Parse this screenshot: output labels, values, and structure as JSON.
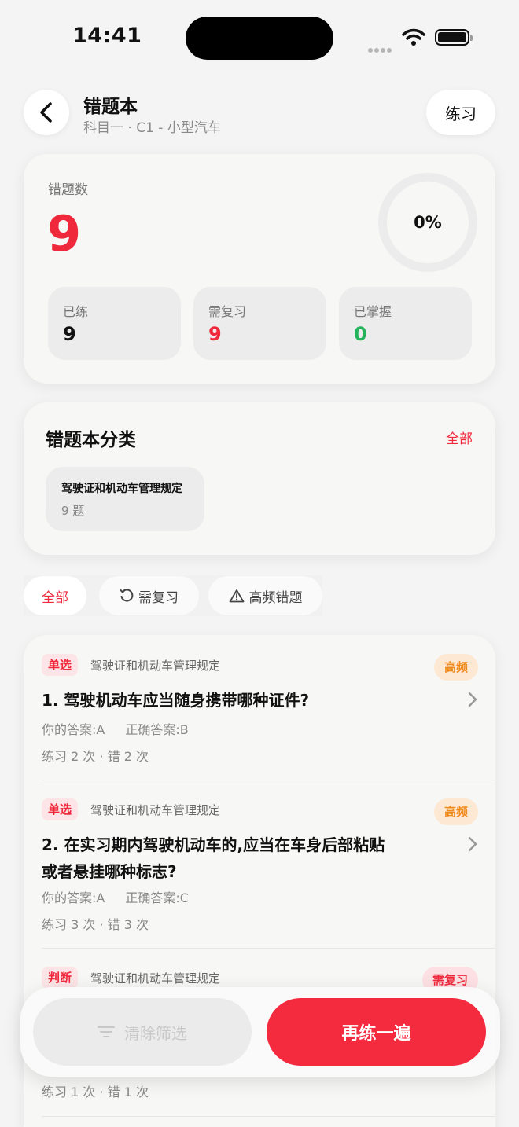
{
  "status_bar": {
    "time": "14:41"
  },
  "header": {
    "title": "错题本",
    "subtitle": "科目一 · C1 - 小型汽车",
    "practice_label": "练习"
  },
  "summary": {
    "wrong_count_label": "错题数",
    "wrong_count": "9",
    "progress_percent": "0%",
    "progress_fraction": 0,
    "stats": [
      {
        "label": "已练",
        "value": "9",
        "color": "#111111"
      },
      {
        "label": "需复习",
        "value": "9",
        "color": "#f0283c"
      },
      {
        "label": "已掌握",
        "value": "0",
        "color": "#22b35b"
      }
    ]
  },
  "categories": {
    "title": "错题本分类",
    "all_label": "全部",
    "items": [
      {
        "name": "驾驶证和机动车管理规定",
        "count": "9 题"
      }
    ]
  },
  "filters": {
    "all": "全部",
    "review": "需复习",
    "frequent": "高频错题"
  },
  "questions": [
    {
      "type": "单选",
      "category": "驾驶证和机动车管理规定",
      "badge": "高频",
      "badge_kind": "freq",
      "text": "1. 驾驶机动车应当随身携带哪种证件?",
      "your_answer": "你的答案:A",
      "correct_answer": "正确答案:B",
      "stats": "练习 2 次 · 错 2 次"
    },
    {
      "type": "单选",
      "category": "驾驶证和机动车管理规定",
      "badge": "高频",
      "badge_kind": "freq",
      "text": "2. 在实习期内驾驶机动车的,应当在车身后部粘贴或者悬挂哪种标志?",
      "your_answer": "你的答案:A",
      "correct_answer": "正确答案:C",
      "stats": "练习 3 次 · 错 3 次"
    },
    {
      "type": "判断",
      "category": "驾驶证和机动车管理规定",
      "badge": "需复习",
      "badge_kind": "review",
      "stats": "练习 1 次 · 错 1 次"
    }
  ],
  "actions": {
    "clear_filter": "清除筛选",
    "retry": "再练一遍"
  }
}
